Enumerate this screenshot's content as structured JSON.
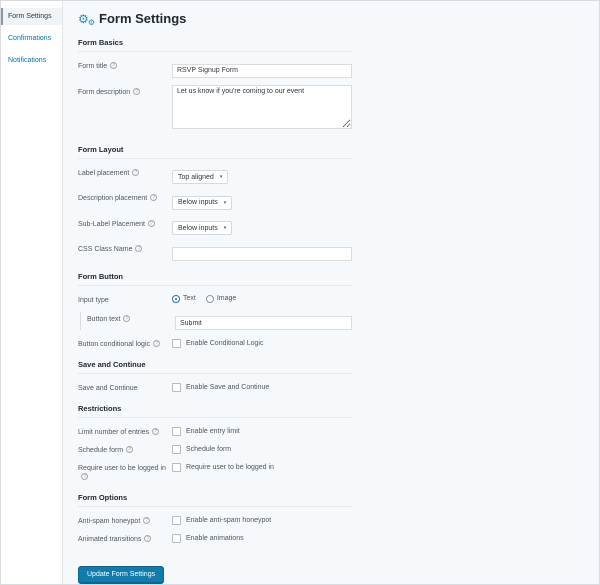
{
  "colors": {
    "accent_blue": "#1e8cbe",
    "link_blue": "#0073aa",
    "button_blue": "#0f7cad",
    "page_bg": "#f6f9fc",
    "panel_white": "#ffffff"
  },
  "sidebar": {
    "items": [
      {
        "label": "Form Settings",
        "active": true
      },
      {
        "label": "Confirmations",
        "active": false
      },
      {
        "label": "Notifications",
        "active": false
      }
    ]
  },
  "header": {
    "icon": "gears-icon",
    "title": "Form Settings"
  },
  "sections": [
    {
      "title": "Form Basics",
      "rows": [
        {
          "label": "Form title",
          "help": true,
          "control": {
            "type": "text",
            "value": "RSVP Signup Form"
          }
        },
        {
          "label": "Form description",
          "help": true,
          "control": {
            "type": "textarea",
            "value": "Let us know if you're coming to our event"
          }
        }
      ]
    },
    {
      "title": "Form Layout",
      "rows": [
        {
          "label": "Label placement",
          "help": true,
          "control": {
            "type": "select",
            "value": "Top aligned"
          }
        },
        {
          "label": "Description placement",
          "help": true,
          "control": {
            "type": "select",
            "value": "Below inputs"
          }
        },
        {
          "label": "Sub-Label Placement",
          "help": true,
          "control": {
            "type": "select",
            "value": "Below inputs"
          }
        },
        {
          "label": "CSS Class Name",
          "help": true,
          "control": {
            "type": "text",
            "value": ""
          }
        }
      ]
    },
    {
      "title": "Form Button",
      "rows": [
        {
          "label": "Input type",
          "help": false,
          "control": {
            "type": "radio-group",
            "options": [
              {
                "label": "Text",
                "checked": true
              },
              {
                "label": "Image",
                "checked": false
              }
            ]
          }
        },
        {
          "label": "Button text",
          "help": true,
          "indent": true,
          "control": {
            "type": "text",
            "value": "Submit"
          }
        },
        {
          "label": "Button conditional logic",
          "help": true,
          "control": {
            "type": "checkbox",
            "label": "Enable Conditional Logic",
            "checked": false
          }
        }
      ]
    },
    {
      "title": "Save and Continue",
      "rows": [
        {
          "label": "Save and Continue",
          "help": false,
          "control": {
            "type": "checkbox",
            "label": "Enable Save and Continue",
            "checked": false
          }
        }
      ]
    },
    {
      "title": "Restrictions",
      "rows": [
        {
          "label": "Limit number of entries",
          "help": true,
          "control": {
            "type": "checkbox",
            "label": "Enable entry limit",
            "checked": false
          }
        },
        {
          "label": "Schedule form",
          "help": true,
          "control": {
            "type": "checkbox",
            "label": "Schedule form",
            "checked": false
          }
        },
        {
          "label": "Require user to be logged in",
          "help": true,
          "control": {
            "type": "checkbox",
            "label": "Require user to be logged in",
            "checked": false
          }
        }
      ]
    },
    {
      "title": "Form Options",
      "rows": [
        {
          "label": "Anti-spam honeypot",
          "help": true,
          "control": {
            "type": "checkbox",
            "label": "Enable anti-spam honeypot",
            "checked": false
          }
        },
        {
          "label": "Animated transitions",
          "help": true,
          "control": {
            "type": "checkbox",
            "label": "Enable animations",
            "checked": false
          }
        }
      ]
    }
  ],
  "footer": {
    "update_button": "Update Form Settings"
  }
}
